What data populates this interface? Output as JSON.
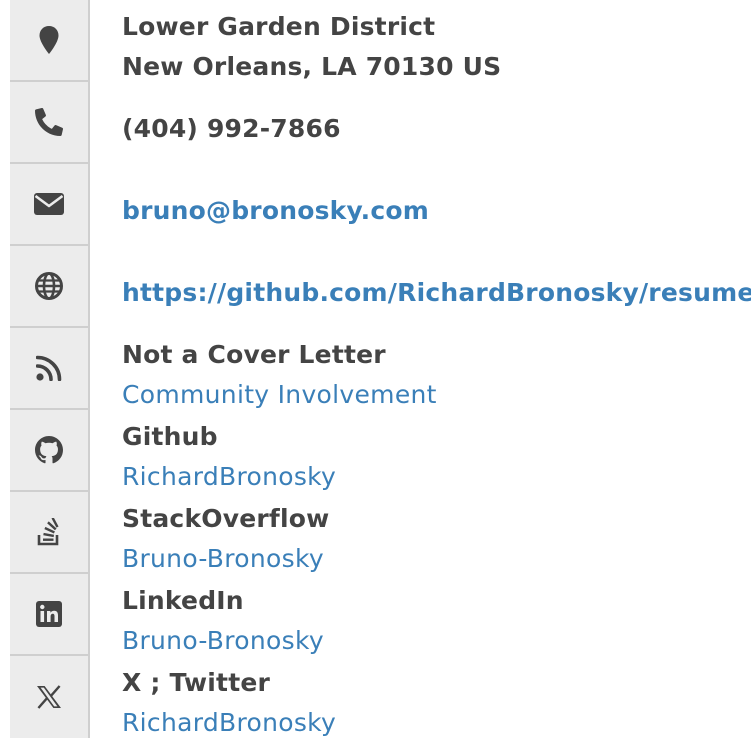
{
  "address": {
    "line1": "Lower Garden District",
    "line2": "New Orleans, LA 70130 US",
    "icon": "map-marker-icon"
  },
  "phone": {
    "number": "(404) 992-7866",
    "icon": "phone-icon"
  },
  "email": {
    "address": "bruno@bronosky.com",
    "icon": "envelope-icon"
  },
  "website": {
    "url": "https://github.com/RichardBronosky/resume",
    "icon": "globe-icon"
  },
  "profiles": [
    {
      "network": "Not a Cover Letter",
      "label": "Community Involvement",
      "icon": "rss-icon"
    },
    {
      "network": "Github",
      "label": "RichardBronosky",
      "icon": "github-icon"
    },
    {
      "network": "StackOverflow",
      "label": "Bruno-Bronosky",
      "icon": "stackoverflow-icon"
    },
    {
      "network": "LinkedIn",
      "label": "Bruno-Bronosky",
      "icon": "linkedin-icon"
    },
    {
      "network": "X ; Twitter",
      "label": "RichardBronosky",
      "icon": "x-twitter-icon"
    }
  ],
  "colors": {
    "text": "#444444",
    "link": "#3a7fb8",
    "icon": "#444444",
    "icon_background": "#ececec",
    "divider": "#cfcfcf"
  }
}
